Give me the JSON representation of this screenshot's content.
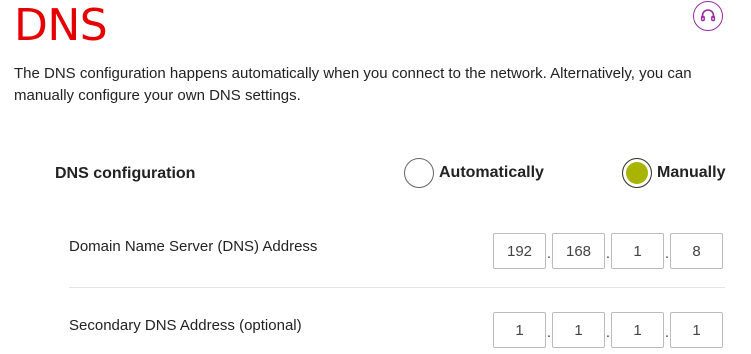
{
  "page": {
    "title": "DNS",
    "description": "The DNS configuration happens automatically when you connect to the network. Alternatively, you can manually configure your own DNS settings."
  },
  "header": {
    "support_icon": "headset-icon",
    "accent_color": "#9c2aa0"
  },
  "dns_configuration": {
    "label": "DNS configuration",
    "options": [
      {
        "label": "Automatically",
        "selected": false
      },
      {
        "label": "Manually",
        "selected": true
      }
    ],
    "selected_color": "#a8b400"
  },
  "primary_dns": {
    "label": "Domain Name Server (DNS) Address",
    "octets": [
      "192",
      "168",
      "1",
      "8"
    ]
  },
  "secondary_dns": {
    "label": "Secondary DNS Address (optional)",
    "octets": [
      "1",
      "1",
      "1",
      "1"
    ]
  },
  "brand_color": "#e60000"
}
